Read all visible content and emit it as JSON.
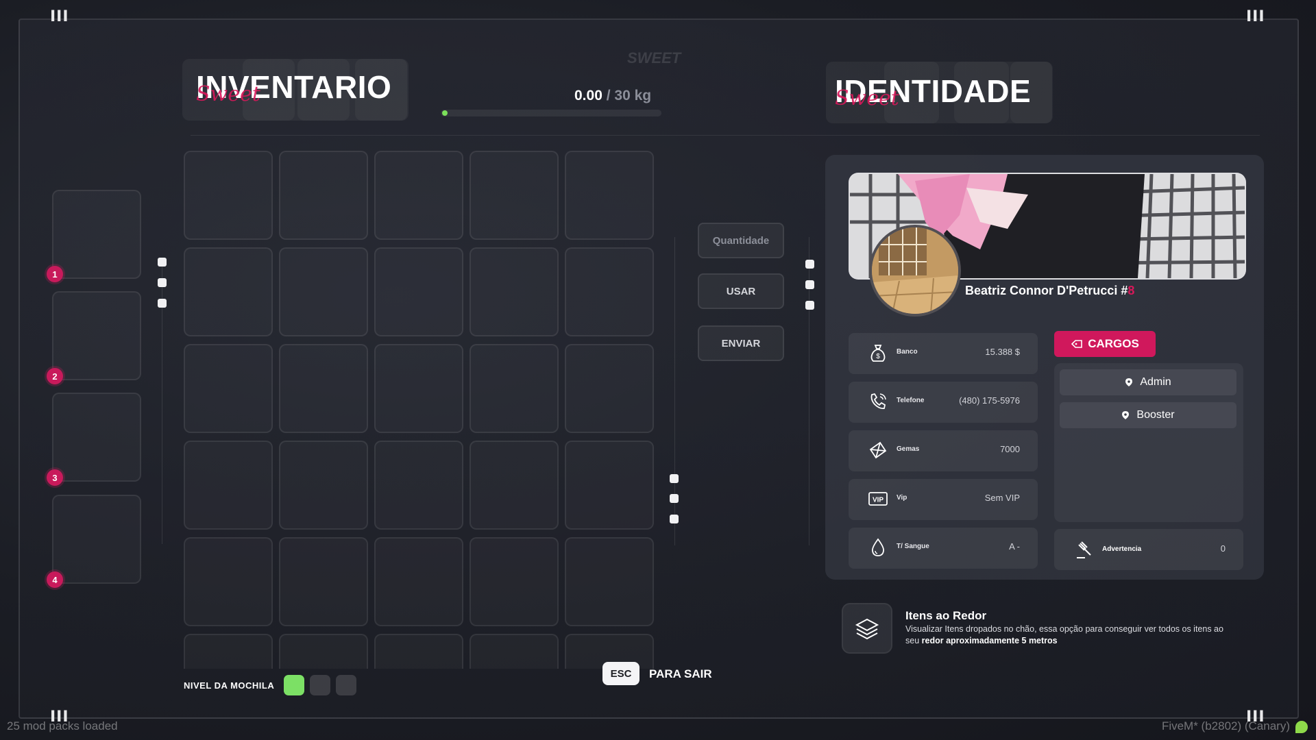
{
  "brand": "SWEET",
  "inventory": {
    "title": "INVENTARIO",
    "script": "Sweet",
    "weight_current": "0.00",
    "weight_max": "/ 30 kg",
    "weight_fraction": 0.0
  },
  "hotbar": {
    "slots": [
      "1",
      "2",
      "3",
      "4"
    ]
  },
  "actions": {
    "quantity_placeholder": "Quantidade",
    "use": "USAR",
    "send": "ENVIAR"
  },
  "backpack": {
    "label": "NIVEL DA MOCHILA",
    "level": 1,
    "max_level": 3
  },
  "exit": {
    "key": "ESC",
    "label": "PARA SAIR"
  },
  "identity": {
    "title": "IDENTIDADE",
    "script": "Sweet",
    "name": "Beatriz Connor D'Petrucci #",
    "id": "8",
    "stats": [
      {
        "icon": "money-bag-icon",
        "label": "Banco",
        "value": "15.388 $"
      },
      {
        "icon": "phone-icon",
        "label": "Telefone",
        "value": "(480) 175-5976"
      },
      {
        "icon": "gem-icon",
        "label": "Gemas",
        "value": "7000"
      },
      {
        "icon": "vip-icon",
        "label": "Vip",
        "value": "Sem VIP"
      },
      {
        "icon": "blood-drop-icon",
        "label": "T/ Sangue",
        "value": "A -"
      }
    ],
    "cargos_label": "CARGOS",
    "roles": [
      "Admin",
      "Booster"
    ],
    "warning": {
      "label": "Advertencia",
      "value": "0"
    }
  },
  "nearby": {
    "title": "Itens ao Redor",
    "desc_prefix": "Visualizar Itens dropados no chão, essa opção para conseguir ver todos os itens ao seu",
    "desc_bold": "redor aproximadamente 5 metros"
  },
  "status": {
    "left": "25 mod packs loaded",
    "right": "FiveM* (b2802) (Canary)"
  },
  "colors": {
    "accent": "#d0185c",
    "level_on": "#7ce065"
  }
}
